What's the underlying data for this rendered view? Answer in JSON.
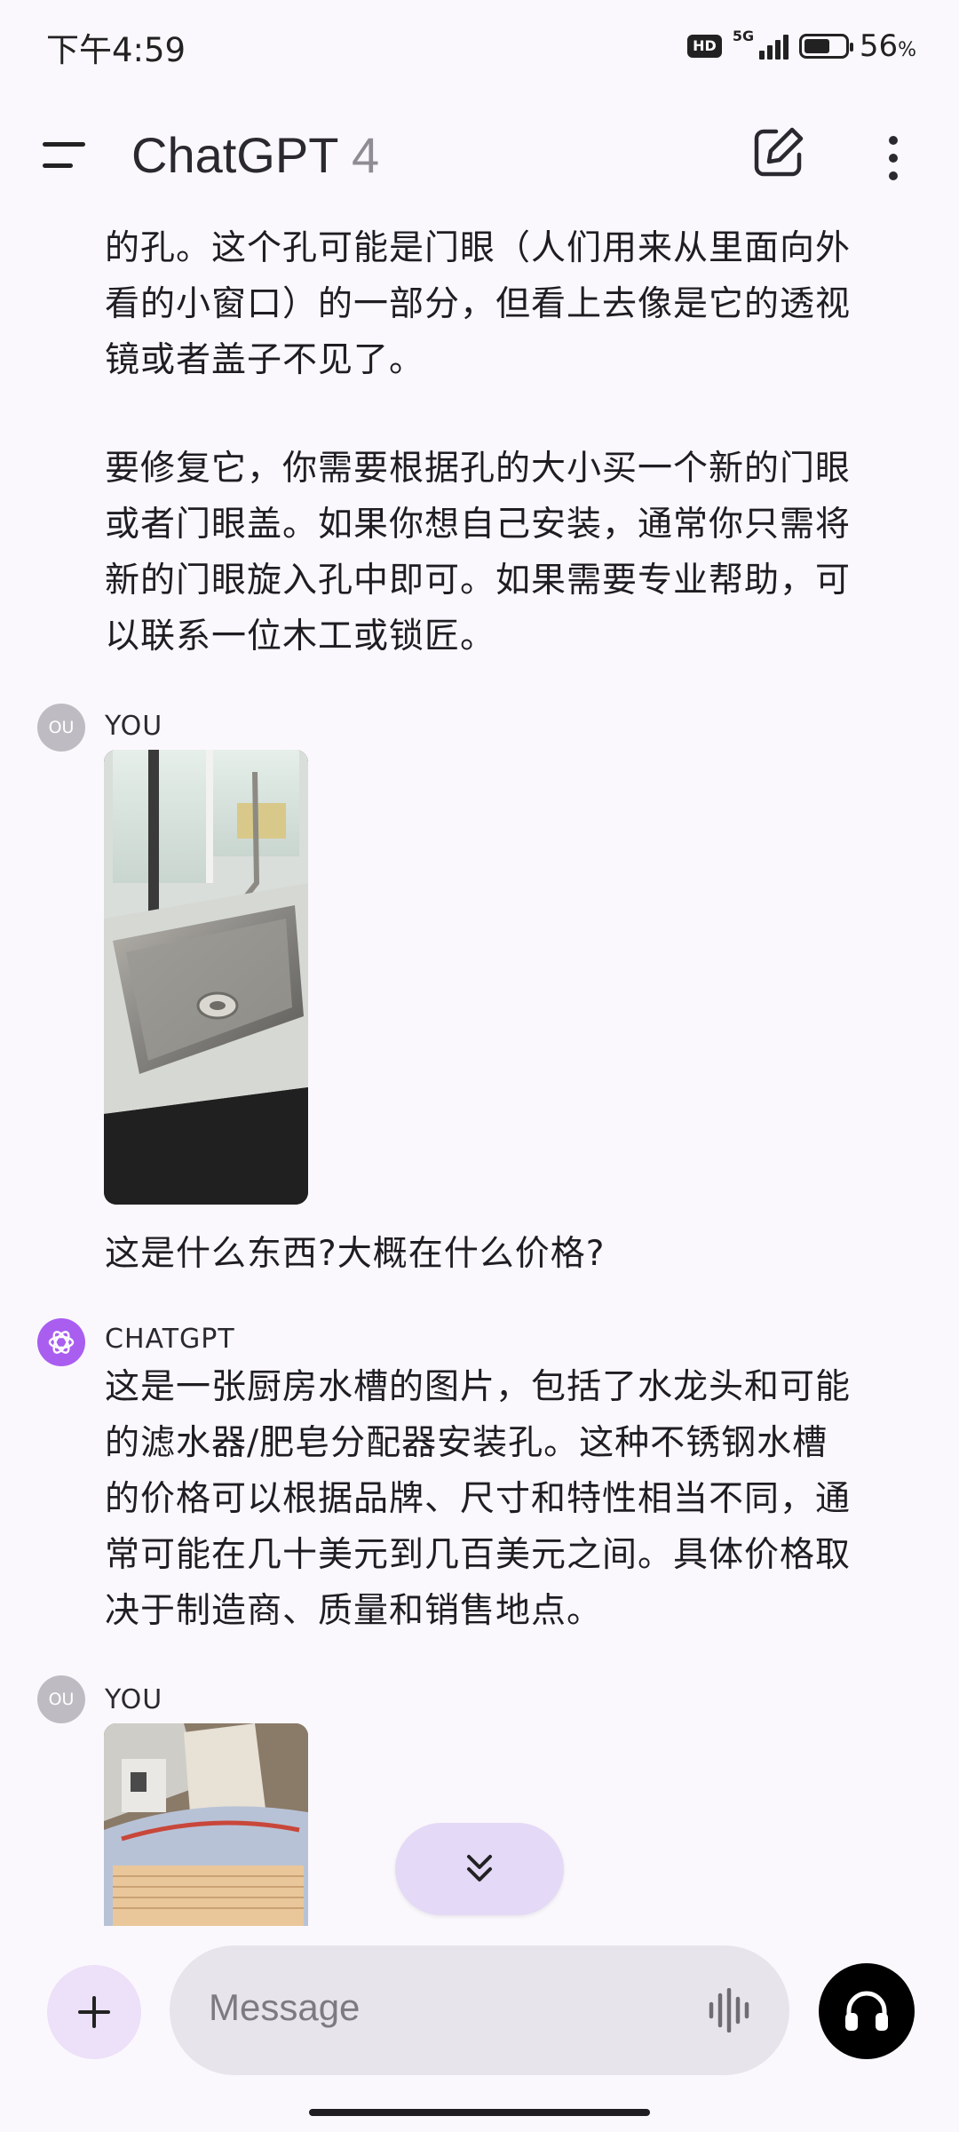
{
  "status_bar": {
    "time": "下午4:59",
    "hd": "HD",
    "network": "5G",
    "battery_percent": "56",
    "battery_unit": "%"
  },
  "header": {
    "app_name": "ChatGPT",
    "version": "4"
  },
  "messages": [
    {
      "role": "assistant",
      "text_lines": [
        "的孔。这个孔可能是门眼（人们用来从里面向外",
        "看的小窗口）的一部分，但看上去像是它的透视",
        "镜或者盖子不见了。"
      ]
    },
    {
      "role": "assistant",
      "text_lines": [
        "要修复它，你需要根据孔的大小买一个新的门眼",
        "或者门眼盖。如果你想自己安装，通常你只需将",
        "新的门眼旋入孔中即可。如果需要专业帮助，可",
        "以联系一位木工或锁匠。"
      ]
    },
    {
      "role": "user",
      "avatar": "OU",
      "sender": "YOU",
      "text": "这是什么东西?大概在什么价格?"
    },
    {
      "role": "assistant",
      "sender": "CHATGPT",
      "text_lines": [
        "这是一张厨房水槽的图片，包括了水龙头和可能",
        "的滤水器/肥皂分配器安装孔。这种不锈钢水槽",
        "的价格可以根据品牌、尺寸和特性相当不同，通",
        "常可能在几十美元到几百美元之间。具体价格取",
        "决于制造商、质量和销售地点。"
      ]
    },
    {
      "role": "user",
      "avatar": "OU",
      "sender": "YOU"
    }
  ],
  "composer": {
    "placeholder": "Message"
  },
  "colors": {
    "background": "#fbf8fd",
    "accent": "#a95ef0",
    "scroll_button": "#e4d9f6"
  }
}
